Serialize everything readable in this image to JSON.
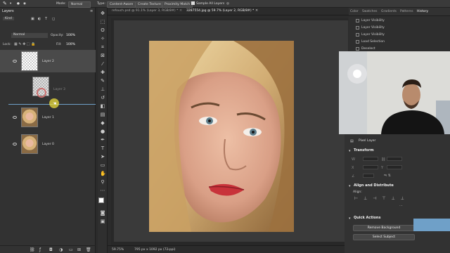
{
  "options_bar": {
    "mode_label": "Mode:",
    "mode_value": "Normal",
    "type_label": "Type:",
    "type_options": [
      "Content-Aware",
      "Create Texture",
      "Proximity Match"
    ],
    "sample_all_layers": "Sample All Layers"
  },
  "layers_panel": {
    "title": "Layers",
    "kind_filter": "Kind",
    "blend_mode": "Normal",
    "opacity_label": "Opacity:",
    "opacity_value": "100%",
    "lock_label": "Lock:",
    "fill_label": "Fill:",
    "fill_value": "100%",
    "layers": [
      {
        "name": "Layer 2"
      },
      {
        "name": "Layer 3"
      },
      {
        "name": "Layer 1"
      },
      {
        "name": "Layer 0"
      }
    ]
  },
  "document_tabs": [
    {
      "label": "refouch.psd @ 91.1% (Layer 3, RGB/8#) *"
    },
    {
      "label": "3287554.jpg @ 59.7% (Layer 2, RGB/8#) *",
      "active": true
    }
  ],
  "status_bar": {
    "zoom": "59.75%",
    "doc_size": "795 px x 1092 px (72 ppi)"
  },
  "right_tabs": [
    {
      "label": "Color"
    },
    {
      "label": "Swatches"
    },
    {
      "label": "Gradients"
    },
    {
      "label": "Patterns"
    },
    {
      "label": "History",
      "active": true
    }
  ],
  "history": {
    "items": [
      "Layer Visibility",
      "Layer Visibility",
      "Layer Visibility",
      "Load Selection",
      "Deselect"
    ]
  },
  "properties": {
    "pixel_layer": "Pixel Layer",
    "transform_heading": "Transform",
    "align_heading": "Align and Distribute",
    "align_label": "Align:",
    "quick_actions_heading": "Quick Actions",
    "remove_background": "Remove Background",
    "select_subject": "Select Subject"
  },
  "colors": {
    "accent": "#6fa0c8",
    "panel_bg": "#323232"
  }
}
